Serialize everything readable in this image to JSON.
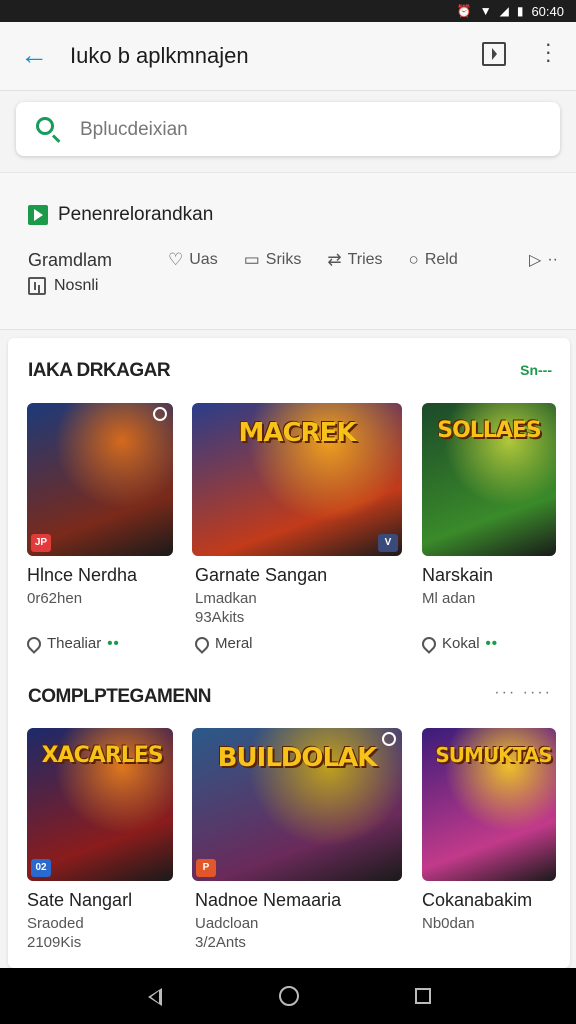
{
  "status": {
    "time": "60:40"
  },
  "appbar": {
    "title": "Iuko b aplkmnajen"
  },
  "search": {
    "placeholder": "Bplucdeixian"
  },
  "filters": {
    "provider": "Penenrelorandkan",
    "main": "Gramdlam",
    "chips": [
      {
        "icon": "tag-icon",
        "label": "Uas"
      },
      {
        "icon": "comment-icon",
        "label": "Sriks"
      },
      {
        "icon": "swap-icon",
        "label": "Tries"
      },
      {
        "icon": "chat-icon",
        "label": "Reld"
      }
    ],
    "more": "··",
    "secondary": "Nosnli"
  },
  "section1": {
    "title": "IAKA DRKAGAR",
    "link": "Sn---",
    "tiles": [
      {
        "name": "Hlnce Nerdha",
        "sub": [
          "0r62hen"
        ],
        "foot": "Thealiar",
        "badge": "JP",
        "badge_color": "#e23b3b",
        "art": [
          "#1c3a7a",
          "#7a2a1a",
          "#d46a1c"
        ]
      },
      {
        "name": "Garnate Sangan",
        "sub": [
          "Lmadkan",
          "93Akits"
        ],
        "foot": "Meral",
        "banner": "MACREK",
        "badge": "V",
        "badge_color": "#3a4a7a",
        "art": [
          "#2a3d8a",
          "#c23b1a",
          "#f0a01c"
        ]
      },
      {
        "name": "Narskain",
        "sub": [
          "Ml adan"
        ],
        "foot": "Kokal",
        "banner": "SOLLAES",
        "art": [
          "#1c4a2a",
          "#3a8a2a",
          "#b0c83a"
        ]
      }
    ]
  },
  "section2": {
    "title": "COMPLPTEGAMENN",
    "dots": "··· ····",
    "tiles": [
      {
        "name": "Sate Nangarl",
        "sub": [
          "Sraoded",
          "2109Kis"
        ],
        "banner": "XACARLES",
        "badge": "02",
        "badge_color": "#2a6ad0",
        "art": [
          "#1c2a6a",
          "#8a1c1c",
          "#e0781c"
        ]
      },
      {
        "name": "Nadnoe Nemaaria",
        "sub": [
          "Uadcloan",
          "3/2Ants"
        ],
        "banner": "BUILDOLAK",
        "badge": "P",
        "badge_color": "#e2572a",
        "art": [
          "#2a5a8a",
          "#6a2a5a",
          "#c0a01c"
        ]
      },
      {
        "name": "Cokanabakim",
        "sub": [
          "Nb0dan"
        ],
        "banner": "SUMUKTAS",
        "art": [
          "#3a1c7a",
          "#c23a8a",
          "#f0c02a"
        ]
      }
    ]
  }
}
